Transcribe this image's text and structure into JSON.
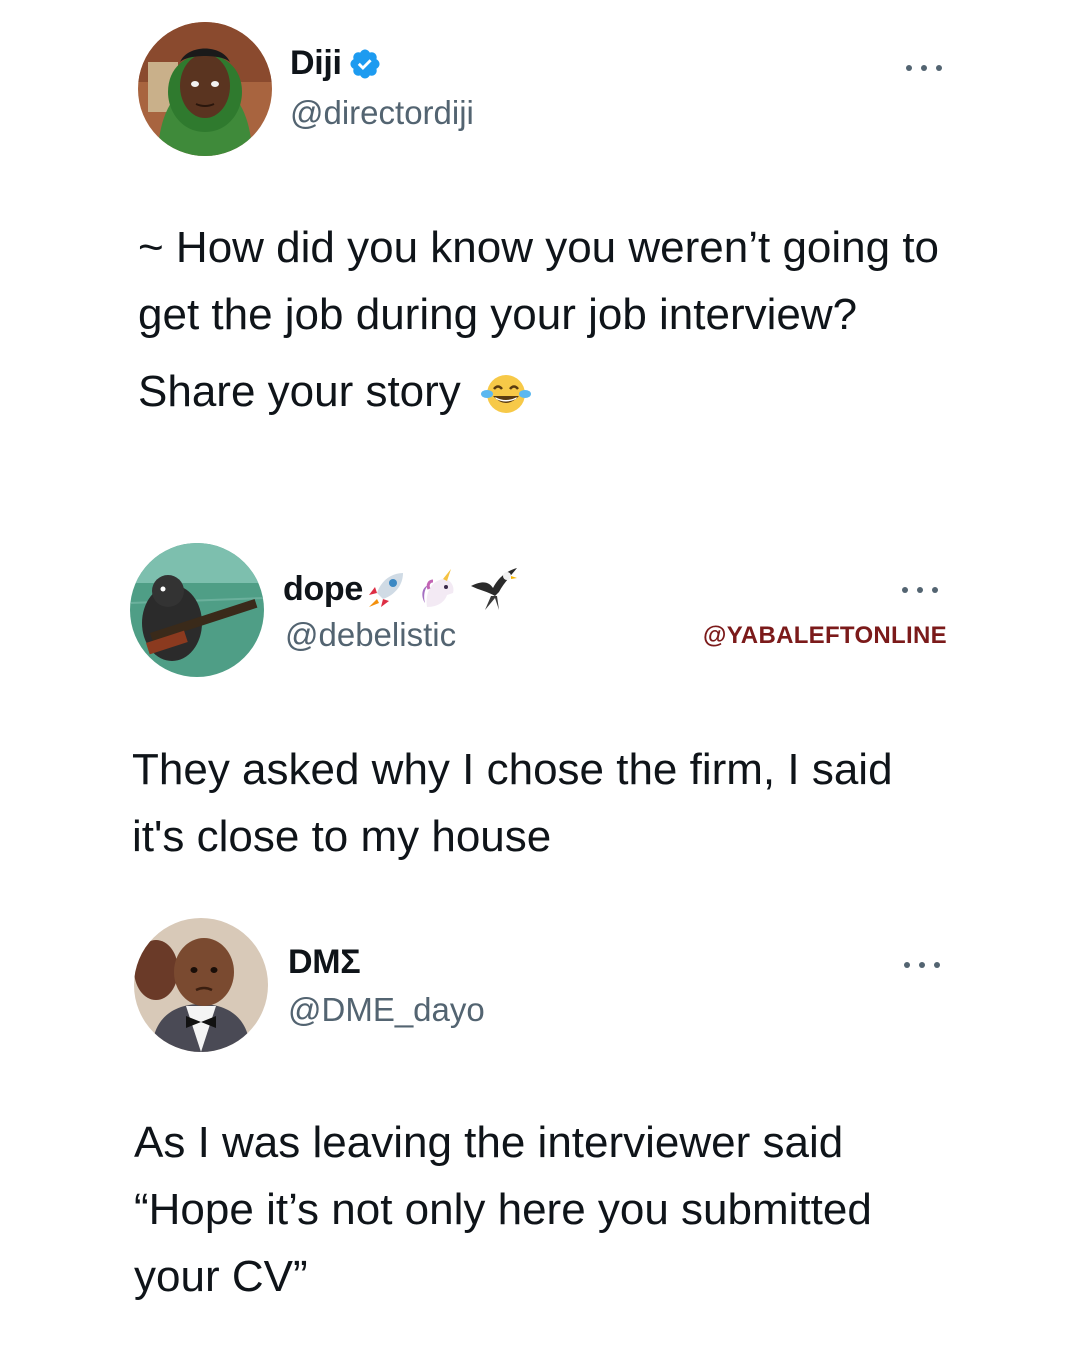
{
  "tweets": [
    {
      "display_name": "Diji",
      "handle": "@directordiji",
      "verified": true,
      "avatar_icon": "person-green-hoodie-avatar",
      "more_icon": "more-options-icon",
      "text_line_1": "~ How did you know you weren’t going to get the job during your job interview?",
      "text_line_2": "Share your story",
      "trailing_emoji": "face-with-tears-of-joy-icon"
    },
    {
      "display_name": "dope",
      "name_emojis": [
        "rocket-icon",
        "unicorn-icon",
        "eagle-icon"
      ],
      "handle": "@debelistic",
      "avatar_icon": "animal-with-rifle-avatar",
      "more_icon": "more-options-icon",
      "text": "They asked why I chose the firm, I said it's close to my house"
    },
    {
      "display_name": "DMΣ",
      "handle": "@DME_dayo",
      "avatar_icon": "child-in-bowtie-avatar",
      "more_icon": "more-options-icon",
      "text": "As I was leaving the interviewer said “Hope it’s not only here you submitted your CV”"
    }
  ],
  "watermark": "@YABALEFTONLINE",
  "colors": {
    "verified_blue": "#1d9bf0",
    "handle_gray": "#536471",
    "text": "#0f1419",
    "watermark": "#7b1a1a"
  }
}
